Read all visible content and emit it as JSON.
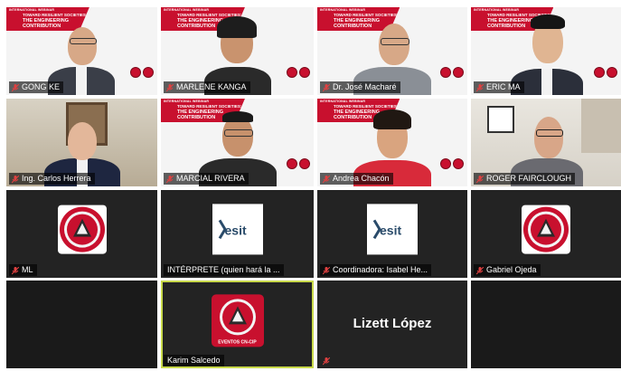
{
  "participants": [
    {
      "name": "GONG KE"
    },
    {
      "name": "MARLENE KANGA"
    },
    {
      "name": "Dr. José Macharé"
    },
    {
      "name": "ERIC MA"
    },
    {
      "name": "Ing. Carlos Herrera"
    },
    {
      "name": "MARCIAL RIVERA"
    },
    {
      "name": "Andrea Chacón"
    },
    {
      "name": "ROGER FAIRCLOUGH"
    },
    {
      "name": "ML"
    },
    {
      "name": "INTÉRPRETE (quien hará la ..."
    },
    {
      "name": "Coordinadora: Isabel He..."
    },
    {
      "name": "Gabriel Ojeda"
    },
    {
      "name": "Karim Salcedo"
    },
    {
      "name": "",
      "display_name": "Lizett López"
    }
  ],
  "banner": {
    "small": "INTERNATIONAL WEBINAR",
    "line1": "TOWARD RESILIENT SOCIETIES:",
    "line2": "THE ENGINEERING",
    "line3": "CONTRIBUTION"
  },
  "logos": {
    "esit": "esit",
    "events": "EVENTOS CN-CIP"
  },
  "colors": {
    "accent_red": "#c8102e",
    "active_speaker": "#c8d94a",
    "tile_bg": "#1a1a1a"
  }
}
